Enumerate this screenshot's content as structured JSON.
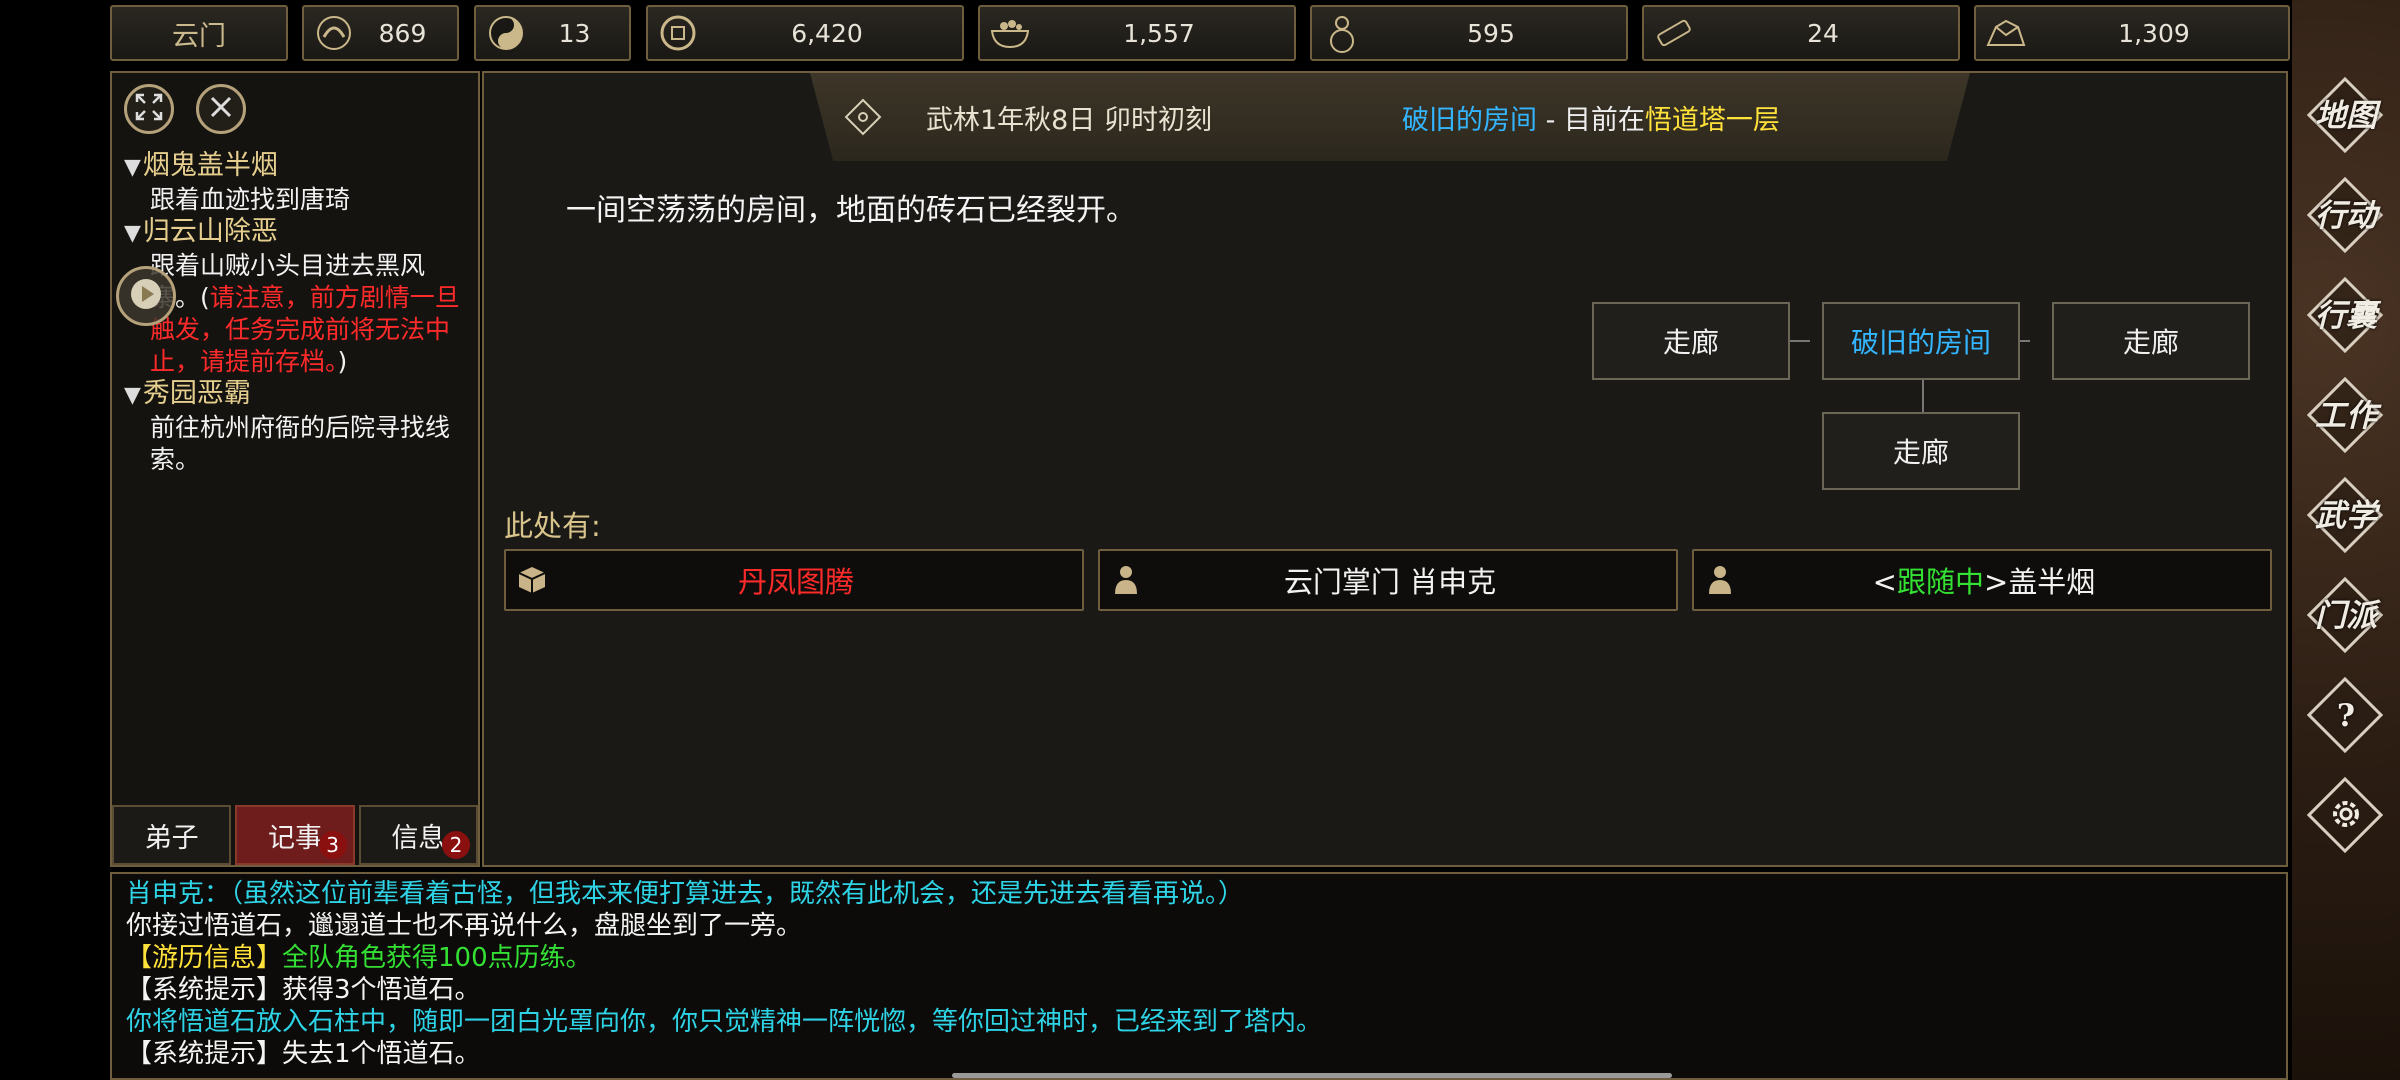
{
  "topbar": {
    "sect": "云门",
    "resources": [
      {
        "icon": "reputation-icon",
        "value": "869"
      },
      {
        "icon": "yin-yang-icon",
        "value": "13"
      },
      {
        "icon": "coin-icon",
        "value": "6,420"
      },
      {
        "icon": "food-bowl-icon",
        "value": "1,557"
      },
      {
        "icon": "gourd-icon",
        "value": "595"
      },
      {
        "icon": "scroll-icon",
        "value": "24"
      },
      {
        "icon": "ore-icon",
        "value": "1,309"
      }
    ]
  },
  "quests": [
    {
      "title": "烟鬼盖半烟",
      "desc": "跟着血迹找到唐琦"
    },
    {
      "title": "归云山除恶",
      "desc_pre": "跟着山贼小头目进去黑风寨。(",
      "desc_warn": "请注意，前方剧情一旦触发，任务完成前将无法中止，请提前存档。",
      "desc_post": ")"
    },
    {
      "title": "秀园恶霸",
      "desc": "前往杭州府衙的后院寻找线索。"
    }
  ],
  "tabs": [
    {
      "label": "弟子",
      "badge": ""
    },
    {
      "label": "记事",
      "badge": "3"
    },
    {
      "label": "信息",
      "badge": "2"
    }
  ],
  "header": {
    "date": "武林1年秋8日 卯时初刻",
    "room": "破旧的房间",
    "sep": " - ",
    "at_label": "目前在",
    "location": "悟道塔一层"
  },
  "description": "一间空荡荡的房间，地面的砖石已经裂开。",
  "map": {
    "west": "走廊",
    "current": "破旧的房间",
    "east": "走廊",
    "south": "走廊"
  },
  "here_label": "此处有:",
  "entities": [
    {
      "icon": "box-icon",
      "label": "丹凤图腾"
    },
    {
      "icon": "person-icon",
      "label": "云门掌门 肖申克"
    },
    {
      "icon": "person-icon",
      "label_pre": "<",
      "label_tag": "跟随中",
      "label_post": ">盖半烟"
    }
  ],
  "right_menu": [
    "地图",
    "行动",
    "行囊",
    "工作",
    "武学",
    "门派"
  ],
  "log": [
    "肖申克：（虽然这位前辈看着古怪，但我本来便打算进去，既然有此机会，还是先进去看看再说。）",
    "你接过悟道石，邋遢道士也不再说什么，盘腿坐到了一旁。",
    "【游历信息】",
    "全队角色获得100点历练。",
    "【系统提示】获得3个悟道石。",
    "你将悟道石放入石柱中，随即一团白光罩向你，你只觉精神一阵恍惚，等你回过神时，已经来到了塔内。",
    "【系统提示】失去1个悟道石。"
  ],
  "colors": {
    "gold_border": "#6e5e3e",
    "blue": "#33b5ff",
    "yellow": "#ffe23a",
    "green": "#33e033",
    "red": "#ff2a2a",
    "cyan": "#2ed3e6"
  }
}
